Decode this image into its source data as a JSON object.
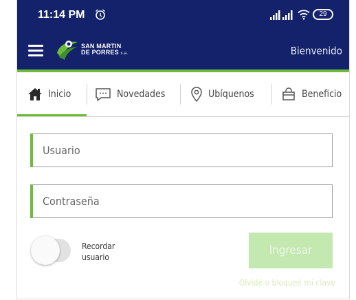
{
  "status_bar": {
    "time": "11:14 PM",
    "battery": "29",
    "icons": [
      "alarm-icon",
      "signal-icon",
      "signal-icon",
      "wifi-icon",
      "battery-icon"
    ]
  },
  "app_bar": {
    "logo_line1": "SAN MARTIN",
    "logo_line2": "DE PORRES",
    "logo_suffix": "s.a.",
    "welcome": "Bienvenido"
  },
  "tabs": [
    {
      "label": "Inicio",
      "icon": "home-icon",
      "active": true
    },
    {
      "label": "Novedades",
      "icon": "chat-icon",
      "active": false
    },
    {
      "label": "Ubíquenos",
      "icon": "location-pin-icon",
      "active": false
    },
    {
      "label": "Beneficio",
      "icon": "bag-icon",
      "active": false
    }
  ],
  "form": {
    "username_placeholder": "Usuario",
    "password_placeholder": "Contraseña",
    "remember_line1": "Recordar",
    "remember_line2": "usuario",
    "remember_on": false,
    "login_label": "Ingresar",
    "forgot_label": "Olvidé o bloqueé mi clave"
  },
  "colors": {
    "navy": "#13226a",
    "accent_green": "#6dbb3a",
    "button_disabled": "#c3e8b0"
  }
}
